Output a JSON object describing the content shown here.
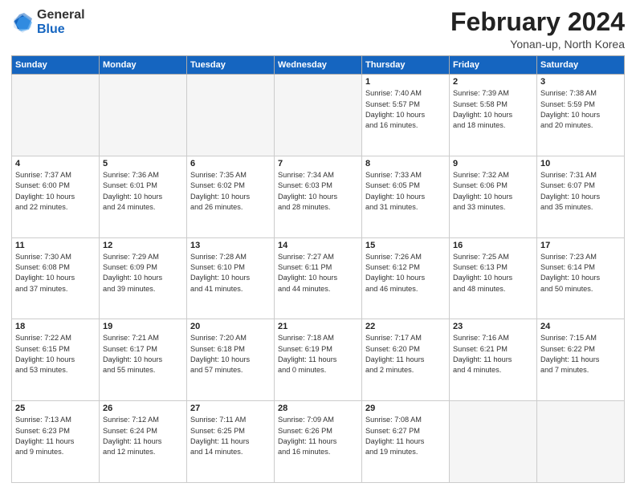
{
  "header": {
    "logo_line1": "General",
    "logo_line2": "Blue",
    "title": "February 2024",
    "subtitle": "Yonan-up, North Korea"
  },
  "weekdays": [
    "Sunday",
    "Monday",
    "Tuesday",
    "Wednesday",
    "Thursday",
    "Friday",
    "Saturday"
  ],
  "weeks": [
    [
      {
        "day": "",
        "info": "",
        "empty": true
      },
      {
        "day": "",
        "info": "",
        "empty": true
      },
      {
        "day": "",
        "info": "",
        "empty": true
      },
      {
        "day": "",
        "info": "",
        "empty": true
      },
      {
        "day": "1",
        "info": "Sunrise: 7:40 AM\nSunset: 5:57 PM\nDaylight: 10 hours\nand 16 minutes.",
        "empty": false
      },
      {
        "day": "2",
        "info": "Sunrise: 7:39 AM\nSunset: 5:58 PM\nDaylight: 10 hours\nand 18 minutes.",
        "empty": false
      },
      {
        "day": "3",
        "info": "Sunrise: 7:38 AM\nSunset: 5:59 PM\nDaylight: 10 hours\nand 20 minutes.",
        "empty": false
      }
    ],
    [
      {
        "day": "4",
        "info": "Sunrise: 7:37 AM\nSunset: 6:00 PM\nDaylight: 10 hours\nand 22 minutes.",
        "empty": false
      },
      {
        "day": "5",
        "info": "Sunrise: 7:36 AM\nSunset: 6:01 PM\nDaylight: 10 hours\nand 24 minutes.",
        "empty": false
      },
      {
        "day": "6",
        "info": "Sunrise: 7:35 AM\nSunset: 6:02 PM\nDaylight: 10 hours\nand 26 minutes.",
        "empty": false
      },
      {
        "day": "7",
        "info": "Sunrise: 7:34 AM\nSunset: 6:03 PM\nDaylight: 10 hours\nand 28 minutes.",
        "empty": false
      },
      {
        "day": "8",
        "info": "Sunrise: 7:33 AM\nSunset: 6:05 PM\nDaylight: 10 hours\nand 31 minutes.",
        "empty": false
      },
      {
        "day": "9",
        "info": "Sunrise: 7:32 AM\nSunset: 6:06 PM\nDaylight: 10 hours\nand 33 minutes.",
        "empty": false
      },
      {
        "day": "10",
        "info": "Sunrise: 7:31 AM\nSunset: 6:07 PM\nDaylight: 10 hours\nand 35 minutes.",
        "empty": false
      }
    ],
    [
      {
        "day": "11",
        "info": "Sunrise: 7:30 AM\nSunset: 6:08 PM\nDaylight: 10 hours\nand 37 minutes.",
        "empty": false
      },
      {
        "day": "12",
        "info": "Sunrise: 7:29 AM\nSunset: 6:09 PM\nDaylight: 10 hours\nand 39 minutes.",
        "empty": false
      },
      {
        "day": "13",
        "info": "Sunrise: 7:28 AM\nSunset: 6:10 PM\nDaylight: 10 hours\nand 41 minutes.",
        "empty": false
      },
      {
        "day": "14",
        "info": "Sunrise: 7:27 AM\nSunset: 6:11 PM\nDaylight: 10 hours\nand 44 minutes.",
        "empty": false
      },
      {
        "day": "15",
        "info": "Sunrise: 7:26 AM\nSunset: 6:12 PM\nDaylight: 10 hours\nand 46 minutes.",
        "empty": false
      },
      {
        "day": "16",
        "info": "Sunrise: 7:25 AM\nSunset: 6:13 PM\nDaylight: 10 hours\nand 48 minutes.",
        "empty": false
      },
      {
        "day": "17",
        "info": "Sunrise: 7:23 AM\nSunset: 6:14 PM\nDaylight: 10 hours\nand 50 minutes.",
        "empty": false
      }
    ],
    [
      {
        "day": "18",
        "info": "Sunrise: 7:22 AM\nSunset: 6:15 PM\nDaylight: 10 hours\nand 53 minutes.",
        "empty": false
      },
      {
        "day": "19",
        "info": "Sunrise: 7:21 AM\nSunset: 6:17 PM\nDaylight: 10 hours\nand 55 minutes.",
        "empty": false
      },
      {
        "day": "20",
        "info": "Sunrise: 7:20 AM\nSunset: 6:18 PM\nDaylight: 10 hours\nand 57 minutes.",
        "empty": false
      },
      {
        "day": "21",
        "info": "Sunrise: 7:18 AM\nSunset: 6:19 PM\nDaylight: 11 hours\nand 0 minutes.",
        "empty": false
      },
      {
        "day": "22",
        "info": "Sunrise: 7:17 AM\nSunset: 6:20 PM\nDaylight: 11 hours\nand 2 minutes.",
        "empty": false
      },
      {
        "day": "23",
        "info": "Sunrise: 7:16 AM\nSunset: 6:21 PM\nDaylight: 11 hours\nand 4 minutes.",
        "empty": false
      },
      {
        "day": "24",
        "info": "Sunrise: 7:15 AM\nSunset: 6:22 PM\nDaylight: 11 hours\nand 7 minutes.",
        "empty": false
      }
    ],
    [
      {
        "day": "25",
        "info": "Sunrise: 7:13 AM\nSunset: 6:23 PM\nDaylight: 11 hours\nand 9 minutes.",
        "empty": false
      },
      {
        "day": "26",
        "info": "Sunrise: 7:12 AM\nSunset: 6:24 PM\nDaylight: 11 hours\nand 12 minutes.",
        "empty": false
      },
      {
        "day": "27",
        "info": "Sunrise: 7:11 AM\nSunset: 6:25 PM\nDaylight: 11 hours\nand 14 minutes.",
        "empty": false
      },
      {
        "day": "28",
        "info": "Sunrise: 7:09 AM\nSunset: 6:26 PM\nDaylight: 11 hours\nand 16 minutes.",
        "empty": false
      },
      {
        "day": "29",
        "info": "Sunrise: 7:08 AM\nSunset: 6:27 PM\nDaylight: 11 hours\nand 19 minutes.",
        "empty": false
      },
      {
        "day": "",
        "info": "",
        "empty": true
      },
      {
        "day": "",
        "info": "",
        "empty": true
      }
    ]
  ]
}
